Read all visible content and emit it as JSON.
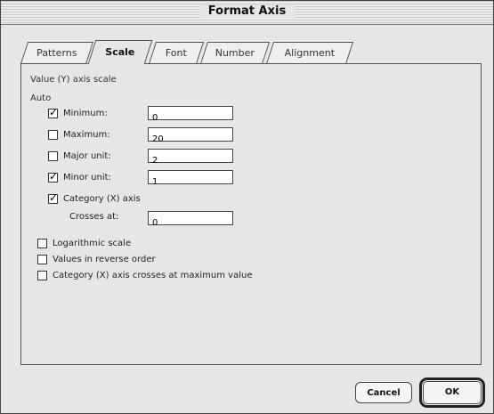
{
  "dialog": {
    "title": "Format Axis"
  },
  "tabs": [
    "Patterns",
    "Scale",
    "Font",
    "Number",
    "Alignment"
  ],
  "active_tab": "Scale",
  "scale": {
    "section_title": "Value (Y) axis scale",
    "auto_label": "Auto",
    "rows": [
      {
        "label": "Minimum:",
        "checked": true,
        "value": "0"
      },
      {
        "label": "Maximum:",
        "checked": false,
        "value": "20"
      },
      {
        "label": "Major unit:",
        "checked": false,
        "value": "2"
      },
      {
        "label": "Minor unit:",
        "checked": true,
        "value": "1"
      },
      {
        "label": "Category (X) axis",
        "checked": true
      }
    ],
    "crosses_label": "Crosses at:",
    "crosses_value": "0",
    "options": [
      {
        "label": "Logarithmic scale",
        "checked": false
      },
      {
        "label": "Values in reverse order",
        "checked": false
      },
      {
        "label": "Category (X) axis crosses at maximum value",
        "checked": false
      }
    ]
  },
  "buttons": {
    "cancel": "Cancel",
    "ok": "OK"
  }
}
